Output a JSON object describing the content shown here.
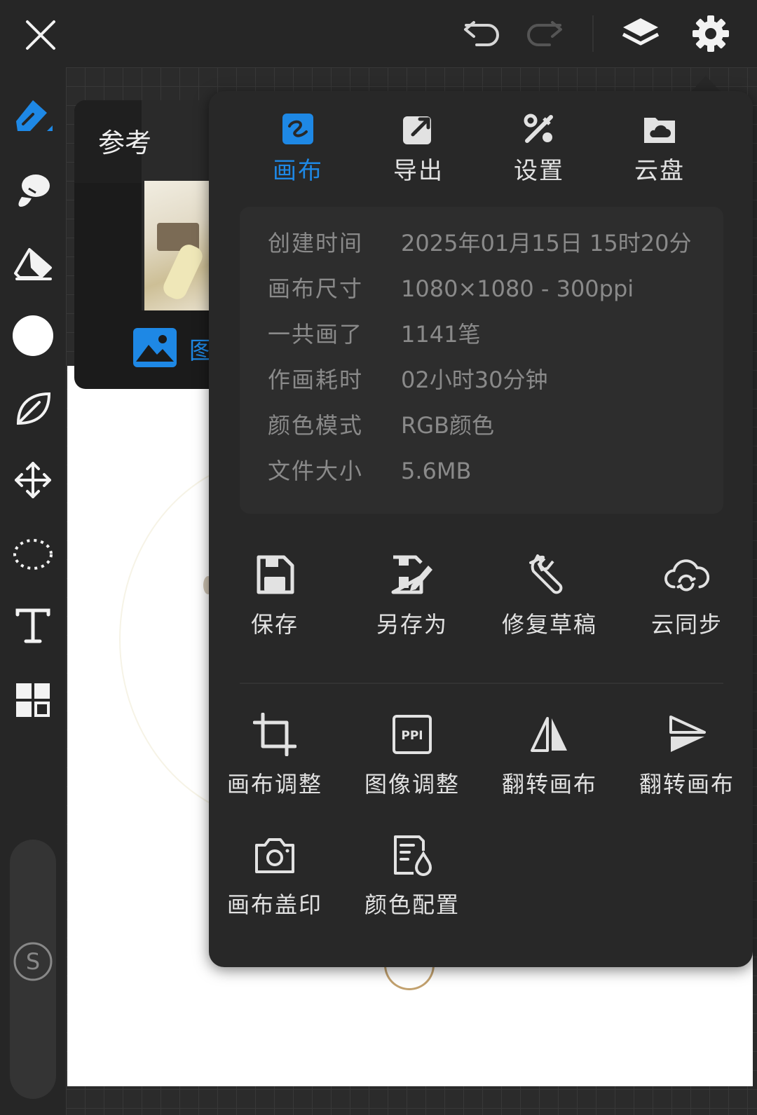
{
  "topbar": {
    "close_icon": "close-icon",
    "undo_icon": "undo-icon",
    "redo_icon": "redo-icon",
    "layers_icon": "layers-icon",
    "settings_icon": "gear-icon"
  },
  "toolbar": {
    "tools": [
      "brush",
      "smudge",
      "eraser",
      "color",
      "leaf",
      "transform",
      "lasso",
      "text",
      "grid"
    ],
    "smudge_label": "S",
    "accent": "#1e88e5"
  },
  "reference": {
    "title": "参考",
    "image_label": "图"
  },
  "menu": {
    "tabs": [
      {
        "label": "画布",
        "icon": "canvas-icon",
        "active": true
      },
      {
        "label": "导出",
        "icon": "export-icon",
        "active": false
      },
      {
        "label": "设置",
        "icon": "tools-icon",
        "active": false
      },
      {
        "label": "云盘",
        "icon": "cloud-folder-icon",
        "active": false
      }
    ],
    "info": [
      {
        "key": "创建时间",
        "value": "2025年01月15日 15时20分"
      },
      {
        "key": "画布尺寸",
        "value": "1080×1080 - 300ppi"
      },
      {
        "key": "一共画了",
        "value": "1141笔"
      },
      {
        "key": "作画耗时",
        "value": "02小时30分钟"
      },
      {
        "key": "颜色模式",
        "value": "RGB颜色"
      },
      {
        "key": "文件大小",
        "value": "5.6MB"
      }
    ],
    "actions_row1": [
      {
        "label": "保存",
        "icon": "save-icon"
      },
      {
        "label": "另存为",
        "icon": "save-as-icon"
      },
      {
        "label": "修复草稿",
        "icon": "wrench-icon"
      },
      {
        "label": "云同步",
        "icon": "cloud-sync-icon"
      }
    ],
    "actions_row2": [
      {
        "label": "画布调整",
        "icon": "crop-icon"
      },
      {
        "label": "图像调整",
        "icon": "ppi-icon",
        "icon_text": "PPI"
      },
      {
        "label": "翻转画布",
        "icon": "flip-horizontal-icon"
      },
      {
        "label": "翻转画布",
        "icon": "flip-vertical-icon"
      }
    ],
    "actions_row3": [
      {
        "label": "画布盖印",
        "icon": "camera-icon"
      },
      {
        "label": "颜色配置",
        "icon": "color-config-icon"
      }
    ]
  }
}
